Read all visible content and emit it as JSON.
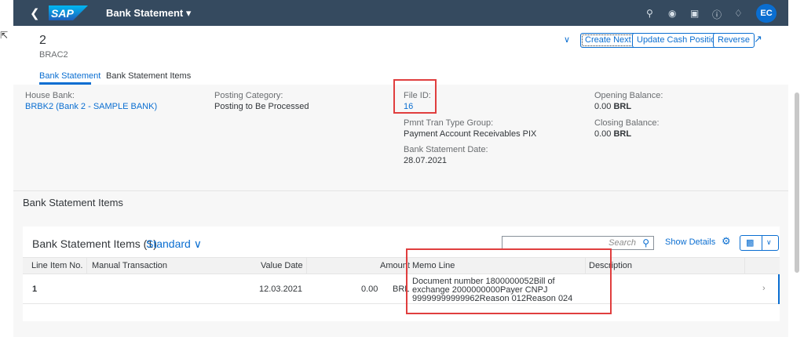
{
  "shell": {
    "title": "Bank Statement ▾",
    "avatar": "EC",
    "icons": [
      "search-icon",
      "copilot-icon",
      "notification-bubble-icon",
      "help-icon",
      "bell-icon"
    ]
  },
  "header": {
    "title": "2",
    "subtitle": "BRAC2",
    "buttons": {
      "create_next": "Create Next",
      "update_cash": "Update Cash Position",
      "reverse": "Reverse"
    },
    "tabs": [
      "Bank Statement",
      "Bank Statement Items"
    ]
  },
  "fields": {
    "house_bank": {
      "label": "House Bank:",
      "value": "BRBK2 (Bank 2 - SAMPLE BANK)"
    },
    "posting_category": {
      "label": "Posting Category:",
      "value": "Posting to Be Processed"
    },
    "file_id": {
      "label": "File ID:",
      "value": "16"
    },
    "pmnt_tran": {
      "label": "Pmnt Tran Type Group:",
      "value": "Payment Account Receivables PIX"
    },
    "stmt_date": {
      "label": "Bank Statement Date:",
      "value": "28.07.2021"
    },
    "opening": {
      "label": "Opening Balance:",
      "amount": "0.00",
      "currency": "BRL"
    },
    "closing": {
      "label": "Closing Balance:",
      "amount": "0.00",
      "currency": "BRL"
    }
  },
  "section_title": "Bank Statement Items",
  "table": {
    "title": "Bank Statement Items (1)",
    "variant": "Standard ∨",
    "search_placeholder": "Search",
    "show_details": "Show Details",
    "columns": [
      "Line Item No.",
      "Manual Transaction",
      "Value Date",
      "Amount",
      "Memo Line",
      "Description"
    ],
    "rows": [
      {
        "line_item": "1",
        "manual_transaction": "",
        "value_date": "12.03.2021",
        "amount": "0.00",
        "currency": "BRL",
        "memo": "Document number 1800000052Bill of exchange 2000000000Payer CNPJ 99999999999962Reason 012Reason 024",
        "description": ""
      }
    ]
  },
  "colors": {
    "shell": "#354a5f",
    "accent": "#0a6ed1",
    "highlight": "#e03e3e"
  }
}
